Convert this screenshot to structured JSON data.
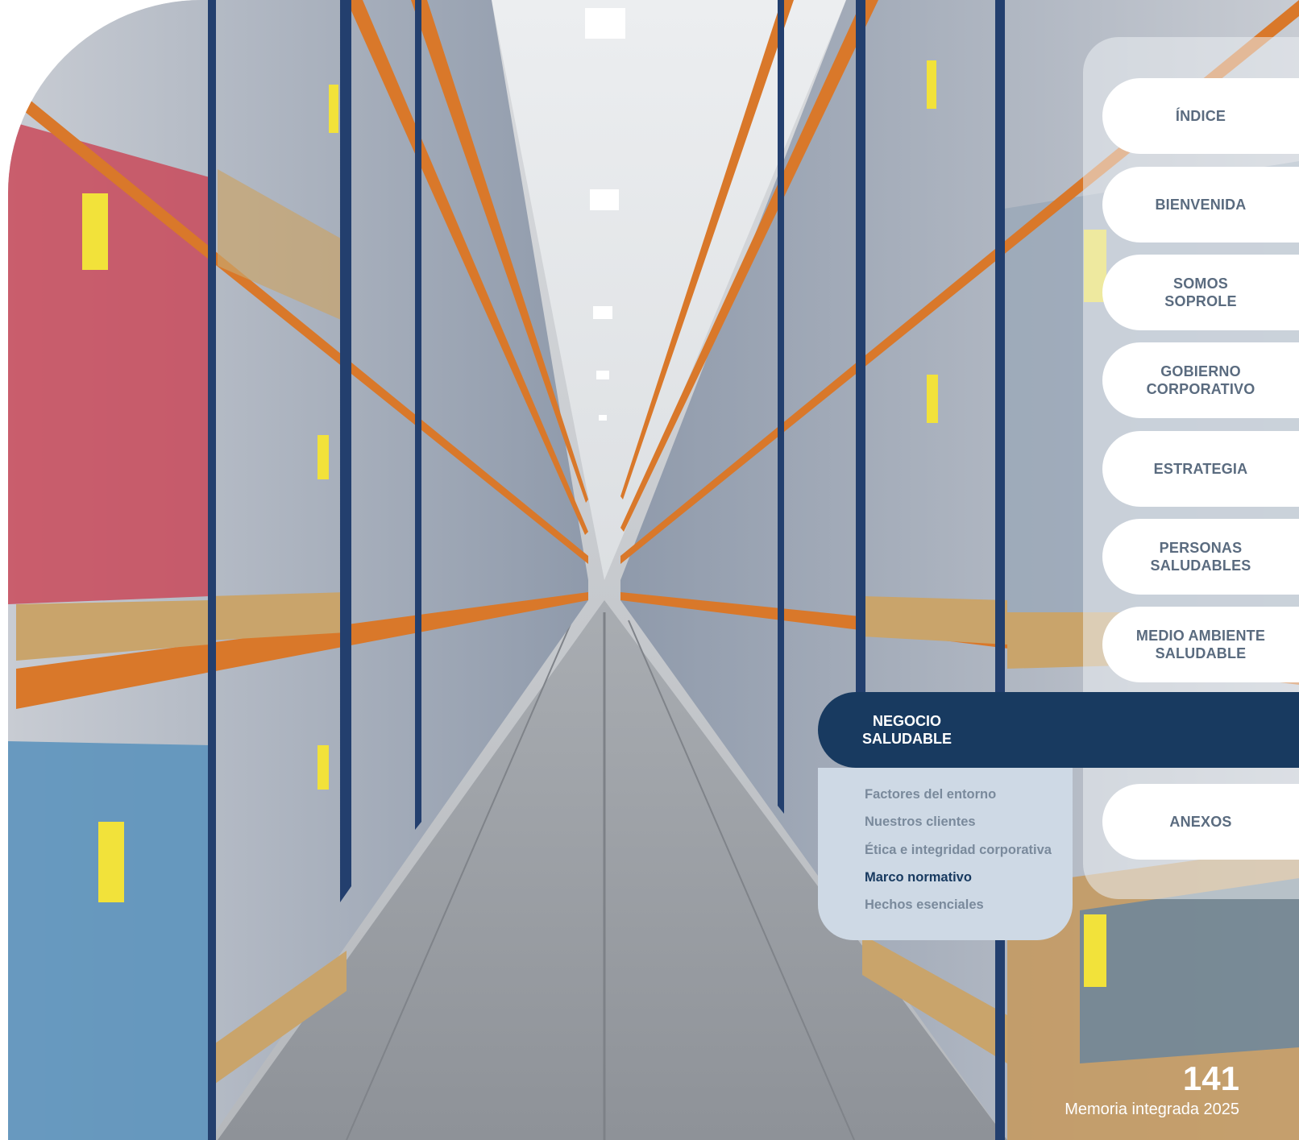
{
  "navigation": {
    "items": [
      {
        "label": "ÍNDICE"
      },
      {
        "label": "BIENVENIDA"
      },
      {
        "label": "SOMOS\nSOPROLE"
      },
      {
        "label": "GOBIERNO\nCORPORATIVO"
      },
      {
        "label": "ESTRATEGIA"
      },
      {
        "label": "PERSONAS\nSALUDABLES"
      },
      {
        "label": "MEDIO AMBIENTE\nSALUDABLE"
      },
      {
        "label": "ANEXOS"
      }
    ],
    "active_section": {
      "label": "NEGOCIO\nSALUDABLE",
      "subitems": [
        {
          "label": "Factores del entorno"
        },
        {
          "label": "Nuestros clientes"
        },
        {
          "label": "Ética e integridad corporativa"
        },
        {
          "label": "Marco normativo",
          "current": true
        },
        {
          "label": "Hechos esenciales"
        }
      ]
    }
  },
  "footer": {
    "page_number": "141",
    "document_name": "Memoria integrada 2025"
  },
  "colors": {
    "accent": "#183a60",
    "nav_text": "#5a6b7f",
    "submenu_bg": "#ced9e5",
    "rack_orange": "#d9782a"
  }
}
